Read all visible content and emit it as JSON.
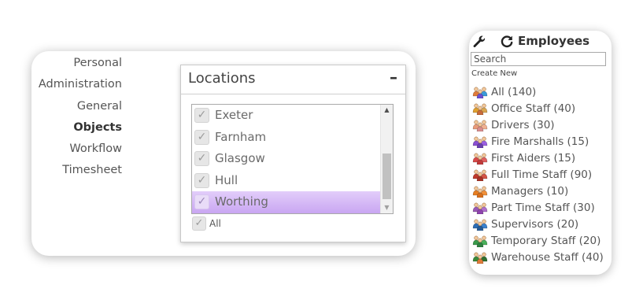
{
  "sidebar": {
    "items": [
      {
        "label": "Personal",
        "active": false
      },
      {
        "label": "Administration",
        "active": false
      },
      {
        "label": "General",
        "active": false
      },
      {
        "label": "Objects",
        "active": true
      },
      {
        "label": "Workflow",
        "active": false
      },
      {
        "label": "Timesheet",
        "active": false
      }
    ]
  },
  "locations": {
    "title": "Locations",
    "collapse_icon": "minus-icon",
    "items": [
      {
        "label": "Exeter",
        "checked": true,
        "selected": false
      },
      {
        "label": "Farnham",
        "checked": true,
        "selected": false
      },
      {
        "label": "Glasgow",
        "checked": true,
        "selected": false
      },
      {
        "label": "Hull",
        "checked": true,
        "selected": false
      },
      {
        "label": "Worthing",
        "checked": true,
        "selected": true
      }
    ],
    "all_label": "All",
    "all_checked": true,
    "selected_color": "#c9a6f2"
  },
  "employees": {
    "title": "Employees",
    "search_placeholder": "Search",
    "create_new": "Create New",
    "groups": [
      {
        "label": "All (140)",
        "colors": [
          "#e07b39",
          "#6a4fd1",
          "#3a9ad9"
        ]
      },
      {
        "label": "Office Staff (40)",
        "colors": [
          "#e0a030",
          "#c76a3a",
          "#d9a650"
        ]
      },
      {
        "label": "Drivers (30)",
        "colors": [
          "#e89a7a",
          "#d98d8d",
          "#f0b090"
        ]
      },
      {
        "label": "Fire Marshalls (15)",
        "colors": [
          "#8a4fd1",
          "#6a3fb0",
          "#9a5fe0"
        ]
      },
      {
        "label": "First Aiders (15)",
        "colors": [
          "#d94a4a",
          "#c03a3a",
          "#e06060"
        ]
      },
      {
        "label": "Full Time Staff (90)",
        "colors": [
          "#c0392b",
          "#a93226",
          "#d35445"
        ]
      },
      {
        "label": "Managers (10)",
        "colors": [
          "#e67e22",
          "#d86e1a",
          "#f0903a"
        ]
      },
      {
        "label": "Part Time Staff (30)",
        "colors": [
          "#9b59b6",
          "#8e44ad",
          "#b06fcc"
        ]
      },
      {
        "label": "Supervisors (20)",
        "colors": [
          "#2e6db4",
          "#255a96",
          "#3a80cc"
        ]
      },
      {
        "label": "Temporary Staff (20)",
        "colors": [
          "#3a9a4a",
          "#2e8040",
          "#4ab05a"
        ]
      },
      {
        "label": "Warehouse Staff (40)",
        "colors": [
          "#3a8a3a",
          "#e07b39",
          "#2e7030"
        ]
      }
    ]
  }
}
